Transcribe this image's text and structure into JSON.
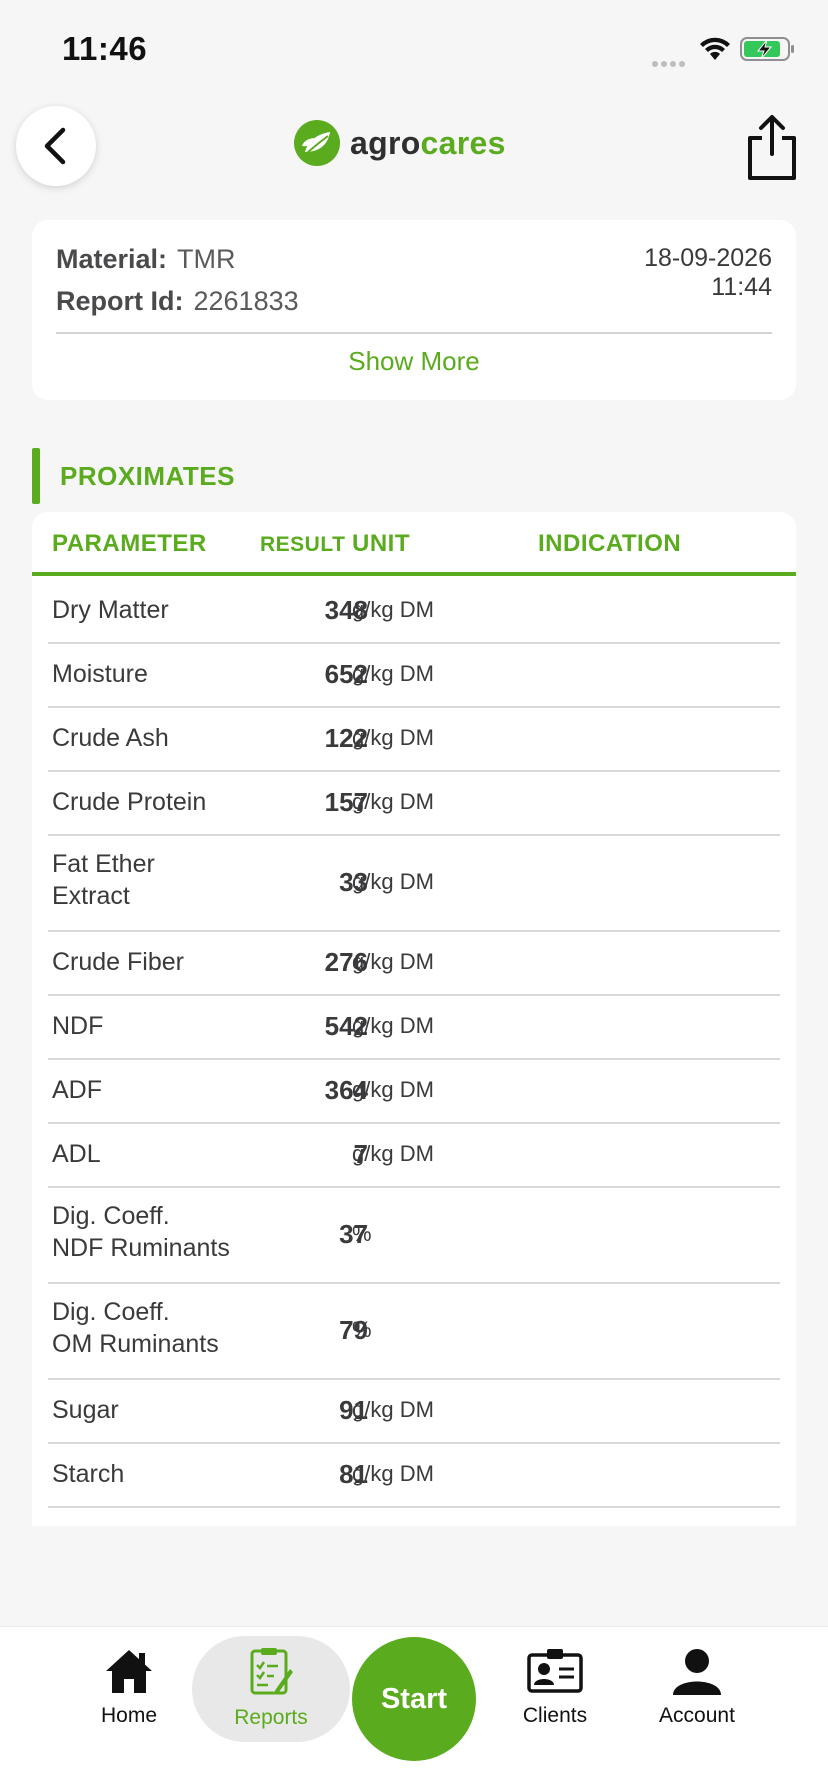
{
  "status_bar": {
    "time": "11:46"
  },
  "header": {
    "logo_part1": "agro",
    "logo_part2": "cares"
  },
  "report": {
    "material_label": "Material:",
    "material_value": "TMR",
    "report_id_label": "Report Id:",
    "report_id_value": "2261833",
    "date": "18-09-2026",
    "time": "11:44",
    "show_more": "Show More"
  },
  "section": {
    "title": "PROXIMATES"
  },
  "table": {
    "headers": {
      "parameter": "PARAMETER",
      "result": "RESULT",
      "unit": "UNIT",
      "indication": "INDICATION"
    },
    "rows": [
      {
        "name": "Dry Matter",
        "value": "348",
        "unit": "g/kg DM"
      },
      {
        "name": "Moisture",
        "value": "652",
        "unit": "g/kg DM"
      },
      {
        "name": "Crude Ash",
        "value": "122",
        "unit": "g/kg DM"
      },
      {
        "name": "Crude Protein",
        "value": "157",
        "unit": "g/kg DM"
      },
      {
        "name": "Fat Ether\nExtract",
        "value": "33",
        "unit": "g/kg DM"
      },
      {
        "name": "Crude Fiber",
        "value": "276",
        "unit": "g/kg DM"
      },
      {
        "name": "NDF",
        "value": "542",
        "unit": "g/kg DM"
      },
      {
        "name": "ADF",
        "value": "364",
        "unit": "g/kg DM"
      },
      {
        "name": "ADL",
        "value": "7",
        "unit": "g/kg DM"
      },
      {
        "name": "Dig. Coeff.\nNDF Ruminants",
        "value": "37",
        "unit": "%"
      },
      {
        "name": "Dig. Coeff.\nOM Ruminants",
        "value": "79",
        "unit": "%"
      },
      {
        "name": "Sugar",
        "value": "91",
        "unit": "g/kg DM"
      },
      {
        "name": "Starch",
        "value": "81",
        "unit": "g/kg DM"
      }
    ]
  },
  "tabbar": {
    "home": "Home",
    "reports": "Reports",
    "start": "Start",
    "clients": "Clients",
    "account": "Account"
  },
  "colors": {
    "accent": "#5aab1e",
    "background": "#f6f6f7",
    "card": "#ffffff"
  }
}
